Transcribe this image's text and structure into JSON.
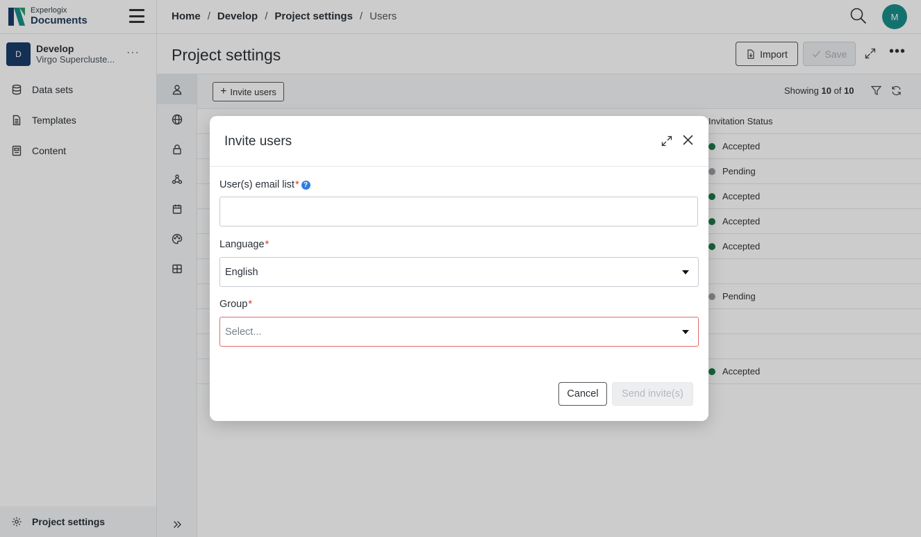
{
  "brand": {
    "line1": "Experlogix",
    "line2": "Documents"
  },
  "project": {
    "avatar": "D",
    "name": "Develop",
    "subtitle": "Virgo Supercluste...",
    "more": "···"
  },
  "nav": {
    "items": [
      {
        "label": "Data sets",
        "icon": "database-icon"
      },
      {
        "label": "Templates",
        "icon": "document-icon"
      },
      {
        "label": "Content",
        "icon": "content-icon"
      }
    ],
    "footer": {
      "label": "Project settings",
      "icon": "gear-icon"
    }
  },
  "breadcrumb": {
    "items": [
      "Home",
      "Develop",
      "Project settings"
    ],
    "current": "Users",
    "separator": "/"
  },
  "user": {
    "initial": "M",
    "color": "#1a8f8a"
  },
  "page": {
    "title": "Project settings",
    "import_label": "Import",
    "save_label": "Save"
  },
  "toolbar": {
    "invite_label": "Invite users",
    "showing_prefix": "Showing",
    "showing_count": "10",
    "showing_of": "of",
    "showing_total": "10"
  },
  "table": {
    "status_header": "Invitation Status",
    "rows": [
      {
        "status": "Accepted",
        "color": "#1c7a4a"
      },
      {
        "status": "Pending",
        "color": "#9aa0a6"
      },
      {
        "status": "Accepted",
        "color": "#1c7a4a"
      },
      {
        "status": "Accepted",
        "color": "#1c7a4a"
      },
      {
        "status": "Accepted",
        "color": "#1c7a4a"
      },
      {
        "status": "",
        "color": ""
      },
      {
        "status": "Pending",
        "color": "#9aa0a6"
      },
      {
        "status": "",
        "color": ""
      },
      {
        "status": "",
        "color": ""
      },
      {
        "status": "Accepted",
        "color": "#1c7a4a"
      }
    ]
  },
  "modal": {
    "title": "Invite users",
    "email": {
      "label": "User(s) email list",
      "required": "*",
      "help": "?",
      "value": ""
    },
    "language": {
      "label": "Language",
      "required": "*",
      "value": "English"
    },
    "group": {
      "label": "Group",
      "required": "*",
      "placeholder": "Select..."
    },
    "cancel_label": "Cancel",
    "send_label": "Send invite(s)"
  }
}
